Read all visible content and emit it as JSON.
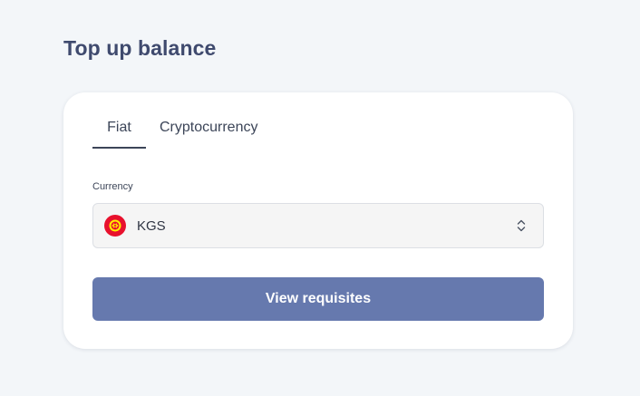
{
  "page": {
    "title": "Top up balance"
  },
  "tabs": [
    {
      "label": "Fiat",
      "active": true
    },
    {
      "label": "Cryptocurrency",
      "active": false
    }
  ],
  "currency": {
    "label": "Currency",
    "selected_value": "KGS",
    "flag_icon": "kyrgyzstan-flag-icon"
  },
  "actions": {
    "view_requisites_label": "View requisites"
  },
  "colors": {
    "background": "#f3f6f9",
    "title": "#3f4a6e",
    "button": "#6679ae",
    "flag_red": "#e8112d",
    "flag_yellow": "#ffef00"
  }
}
